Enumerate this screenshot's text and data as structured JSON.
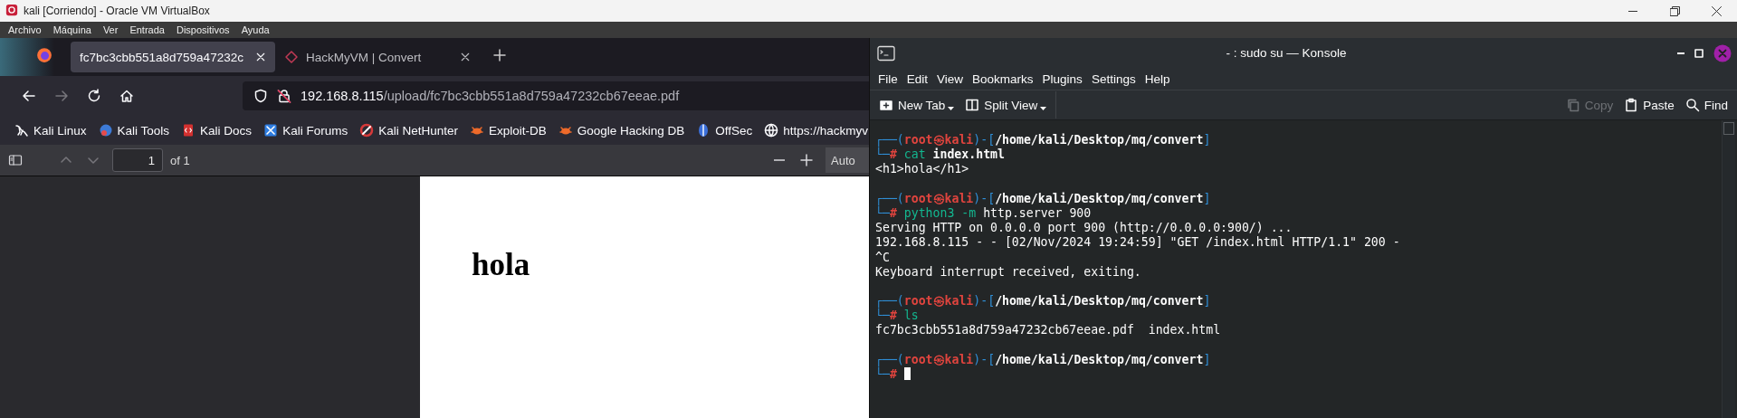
{
  "window": {
    "title": "kali [Corriendo] - Oracle VM VirtualBox"
  },
  "vm_menu": [
    "Archivo",
    "Máquina",
    "Ver",
    "Entrada",
    "Dispositivos",
    "Ayuda"
  ],
  "browser": {
    "tabs": [
      {
        "title": "fc7bc3cbb551a8d759a47232c",
        "selected": true
      },
      {
        "title": "HackMyVM | Convert",
        "selected": false
      }
    ],
    "nav": [
      {
        "kind": "back",
        "disabled": false
      },
      {
        "kind": "forward",
        "disabled": true
      },
      {
        "kind": "reload",
        "disabled": false
      },
      {
        "kind": "home",
        "disabled": false
      }
    ],
    "address": {
      "host": "192.168.8.115",
      "path": "/upload/fc7bc3cbb551a8d759a47232cb67eeae.pdf"
    },
    "bookmarks": [
      {
        "label": "Kali Linux",
        "kind": "dragon"
      },
      {
        "label": "Kali Tools",
        "kind": "tools"
      },
      {
        "label": "Kali Docs",
        "kind": "docs"
      },
      {
        "label": "Kali Forums",
        "kind": "forums"
      },
      {
        "label": "Kali NetHunter",
        "kind": "nethunter"
      },
      {
        "label": "Exploit-DB",
        "kind": "bug"
      },
      {
        "label": "Google Hacking DB",
        "kind": "bug"
      },
      {
        "label": "OffSec",
        "kind": "offsec"
      },
      {
        "label": "https://hackmyv",
        "kind": "globe"
      }
    ],
    "pdf_toolbar": {
      "previous_disabled": true,
      "next_disabled": true,
      "page": "1",
      "page_count": "of 1",
      "zoom": "Auto"
    },
    "pdf_page": {
      "heading": "hola"
    }
  },
  "konsole": {
    "title": "- : sudo su — Konsole",
    "menu": [
      "File",
      "Edit",
      "View",
      "Bookmarks",
      "Plugins",
      "Settings",
      "Help"
    ],
    "toolbar": [
      {
        "label": "New Tab",
        "kind": "new-tab",
        "disabled": false,
        "dropdown": true
      },
      {
        "label": "Split View",
        "kind": "split",
        "disabled": false,
        "dropdown": true
      },
      {
        "label": "Copy",
        "kind": "copy",
        "disabled": true,
        "dropdown": false
      },
      {
        "label": "Paste",
        "kind": "paste",
        "disabled": false,
        "dropdown": false
      },
      {
        "label": "Find",
        "kind": "find",
        "disabled": false,
        "dropdown": false
      }
    ],
    "lines": [
      {
        "kind": "text",
        "segments": [
          {
            "text": "┌──(",
            "kind": "frame"
          },
          {
            "text": "root㉿kali",
            "kind": "user"
          },
          {
            "text": ")-[",
            "kind": "frame"
          },
          {
            "text": "/home/kali/Desktop/mq/convert",
            "kind": "path"
          },
          {
            "text": "]",
            "kind": "frame"
          }
        ]
      },
      {
        "kind": "text",
        "segments": [
          {
            "text": "└─",
            "kind": "frame"
          },
          {
            "text": "#",
            "kind": "user"
          },
          {
            "text": " cat",
            "kind": "program"
          },
          {
            "text": " index.html",
            "kind": "bold"
          }
        ]
      },
      {
        "kind": "text",
        "segments": [
          {
            "text": "<h1>hola</h1>",
            "kind": "plain"
          }
        ]
      },
      {
        "kind": "blank"
      },
      {
        "kind": "text",
        "segments": [
          {
            "text": "┌──(",
            "kind": "frame"
          },
          {
            "text": "root㉿kali",
            "kind": "user"
          },
          {
            "text": ")-[",
            "kind": "frame"
          },
          {
            "text": "/home/kali/Desktop/mq/convert",
            "kind": "path"
          },
          {
            "text": "]",
            "kind": "frame"
          }
        ]
      },
      {
        "kind": "text",
        "segments": [
          {
            "text": "└─",
            "kind": "frame"
          },
          {
            "text": "#",
            "kind": "user"
          },
          {
            "text": " python3 -m",
            "kind": "program"
          },
          {
            "text": " http.server 900",
            "kind": "plain"
          }
        ]
      },
      {
        "kind": "text",
        "segments": [
          {
            "text": "Serving HTTP on 0.0.0.0 port 900 (http://0.0.0.0:900/) ...",
            "kind": "plain"
          }
        ]
      },
      {
        "kind": "text",
        "segments": [
          {
            "text": "192.168.8.115 - - [02/Nov/2024 19:24:59] \"GET /index.html HTTP/1.1\" 200 -",
            "kind": "plain"
          }
        ]
      },
      {
        "kind": "text",
        "segments": [
          {
            "text": "^C",
            "kind": "plain"
          }
        ]
      },
      {
        "kind": "text",
        "segments": [
          {
            "text": "Keyboard interrupt received, exiting.",
            "kind": "plain"
          }
        ]
      },
      {
        "kind": "blank"
      },
      {
        "kind": "text",
        "segments": [
          {
            "text": "┌──(",
            "kind": "frame"
          },
          {
            "text": "root㉿kali",
            "kind": "user"
          },
          {
            "text": ")-[",
            "kind": "frame"
          },
          {
            "text": "/home/kali/Desktop/mq/convert",
            "kind": "path"
          },
          {
            "text": "]",
            "kind": "frame"
          }
        ]
      },
      {
        "kind": "text",
        "segments": [
          {
            "text": "└─",
            "kind": "frame"
          },
          {
            "text": "#",
            "kind": "user"
          },
          {
            "text": " ls",
            "kind": "program"
          }
        ]
      },
      {
        "kind": "text",
        "segments": [
          {
            "text": "fc7bc3cbb551a8d759a47232cb67eeae.pdf  index.html",
            "kind": "plain"
          }
        ]
      },
      {
        "kind": "blank"
      },
      {
        "kind": "text",
        "segments": [
          {
            "text": "┌──(",
            "kind": "frame"
          },
          {
            "text": "root㉿kali",
            "kind": "user"
          },
          {
            "text": ")-[",
            "kind": "frame"
          },
          {
            "text": "/home/kali/Desktop/mq/convert",
            "kind": "path"
          },
          {
            "text": "]",
            "kind": "frame"
          }
        ]
      },
      {
        "kind": "input",
        "segments": [
          {
            "text": "└─",
            "kind": "frame"
          },
          {
            "text": "#",
            "kind": "user"
          }
        ]
      }
    ]
  }
}
